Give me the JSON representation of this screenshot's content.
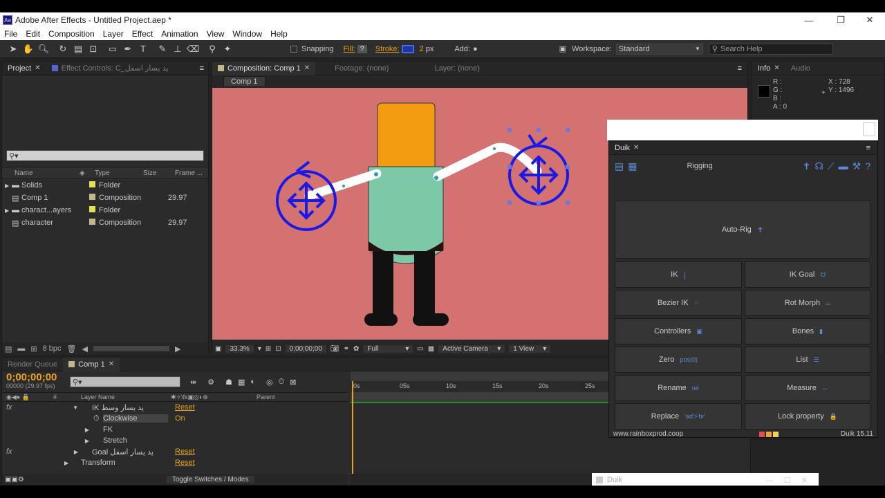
{
  "window": {
    "title": "Adobe After Effects - Untitled Project.aep *",
    "min": "—",
    "max": "❐",
    "close": "✕"
  },
  "menu": [
    "File",
    "Edit",
    "Composition",
    "Layer",
    "Effect",
    "Animation",
    "View",
    "Window",
    "Help"
  ],
  "toolbar": {
    "snapping": "Snapping",
    "fill": "Fill:",
    "fill_q": "?",
    "stroke": "Stroke:",
    "stroke_px": "2",
    "px": "px",
    "add": "Add:",
    "workspace_label": "Workspace:",
    "workspace_value": "Standard",
    "search_placeholder": "Search Help"
  },
  "project": {
    "tab": "Project",
    "effect_controls_tab": "Effect Controls: C_يد يسار اسفل",
    "columns": [
      "Name",
      "Type",
      "Size",
      "Frame ..."
    ],
    "items": [
      {
        "name": "Solids",
        "type": "Folder",
        "fps": "",
        "color": "#e8e04a"
      },
      {
        "name": "Comp 1",
        "type": "Composition",
        "fps": "29.97",
        "color": "#c2b68a"
      },
      {
        "name": "charact...ayers",
        "type": "Folder",
        "fps": "",
        "color": "#e8e04a"
      },
      {
        "name": "character",
        "type": "Composition",
        "fps": "29.97",
        "color": "#c2b68a"
      }
    ],
    "bpc": "8 bpc"
  },
  "composition": {
    "tab": "Composition: Comp 1",
    "footage_tab": "Footage: (none)",
    "layer_tab": "Layer: (none)",
    "subtab": "Comp 1",
    "zoom": "33.3%",
    "timecode": "0;00;00;00",
    "quality": "Full",
    "camera": "Active Camera",
    "views": "1 View",
    "bg_color": "#d47272"
  },
  "info": {
    "tab": "Info",
    "audio_tab": "Audio",
    "r": "R :",
    "g": "G :",
    "b": "B :",
    "a": "A : 0",
    "x": "X : 728",
    "y": "Y : 1496"
  },
  "duik": {
    "tab": "Duik",
    "section": "Rigging",
    "autorig": "Auto-Rig",
    "buttons": [
      {
        "label": "IK",
        "icon": "⸾"
      },
      {
        "label": "IK Goal",
        "icon": "☋"
      },
      {
        "label": "Bezier IK",
        "icon": "⁘"
      },
      {
        "label": "Rot Morph",
        "icon": "⌓"
      },
      {
        "label": "Controllers",
        "icon": "▣"
      },
      {
        "label": "Bones",
        "icon": "▮"
      },
      {
        "label": "Zero",
        "icon": "pos(0)"
      },
      {
        "label": "List",
        "icon": "☰"
      },
      {
        "label": "Rename",
        "icon": "rei"
      },
      {
        "label": "Measure",
        "icon": "↔"
      },
      {
        "label": "Replace",
        "icon": "'ad'>'br'"
      },
      {
        "label": "Lock property",
        "icon": "🔒"
      }
    ],
    "url": "www.rainboxprod.coop",
    "version": "Duik 15.11",
    "mini_title": "Duik"
  },
  "timeline": {
    "render_queue_tab": "Render Queue",
    "comp_tab": "Comp 1",
    "timecode": "0;00;00;00",
    "frames": "00000 (29.97 fps)",
    "col_layer": "Layer Name",
    "col_parent": "Parent",
    "col_hash": "#",
    "ticks": [
      "0s",
      "05s",
      "10s",
      "15s",
      "20s",
      "25s"
    ],
    "rows": [
      {
        "fx": "fx",
        "indent": 1,
        "arrow": "▼",
        "label": "IK  يد يسار وسط",
        "value": "Reset",
        "val_class": "link-blue"
      },
      {
        "fx": "",
        "indent": 2,
        "arrow": "",
        "label": "Clockwise",
        "value": "On",
        "val_class": "orange",
        "stopwatch": "⏱"
      },
      {
        "fx": "",
        "indent": 2,
        "arrow": "▶",
        "label": "FK",
        "value": ""
      },
      {
        "fx": "",
        "indent": 2,
        "arrow": "▶",
        "label": "Stretch",
        "value": ""
      },
      {
        "fx": "fx",
        "indent": 1,
        "arrow": "▶",
        "label": "Goal  يد يسار اسفل",
        "value": "Reset",
        "val_class": "link"
      },
      {
        "fx": "",
        "indent": 0,
        "arrow": "▶",
        "label": "Transform",
        "value": "Reset",
        "val_class": "link"
      }
    ],
    "toggle": "Toggle Switches / Modes"
  }
}
